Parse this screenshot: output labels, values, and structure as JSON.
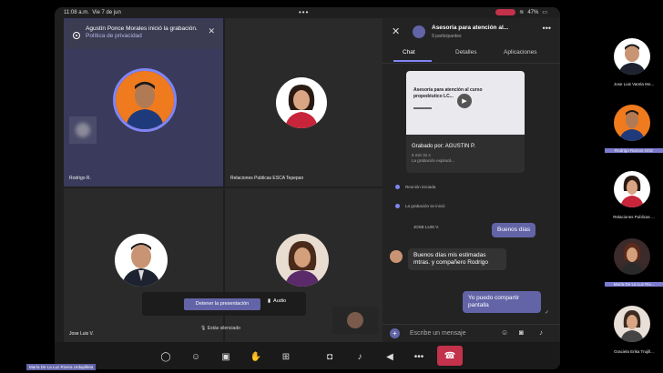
{
  "status_bar": {
    "time": "11:08 a.m.",
    "date": "Vie 7 de jun",
    "battery": "47%",
    "dots": "•••"
  },
  "notification": {
    "text": "Agustín Ponce Morales inició la grabación.",
    "link": "Política de privacidad"
  },
  "tiles": [
    {
      "name": "Rodrigo R.",
      "color": "#f07a1e"
    },
    {
      "name": "Relaciones Publicas ESCA Tepepan"
    },
    {
      "name": "Jose Luis V."
    },
    {
      "name": ""
    }
  ],
  "presentation": {
    "stop_label": "Detener la presentación",
    "audio_label": "Audio"
  },
  "muted_note": "Estás silenciado",
  "panel": {
    "title": "Asesoría para atención al...",
    "subtitle": "9 participantes",
    "tabs": [
      "Chat",
      "Detalles",
      "Aplicaciones"
    ],
    "recording": {
      "thumb_title": "Asesoría para atención al curso propedéutico LC...",
      "by": "Grabado por: AGUSTIN P.",
      "meta1": "5 min 31 s",
      "meta2": "La grabación expirará..."
    },
    "events": [
      "Reunión iniciada",
      "La grabación se inició"
    ],
    "messages": [
      {
        "from": "me",
        "text": "Buenos días"
      },
      {
        "from": "JOSE LUIS V.",
        "text": "Buenos días mis estimadas mtras. y compañero Rodrigo"
      },
      {
        "from": "me",
        "text": "Yo puedo compartir pantalla"
      }
    ],
    "compose_placeholder": "Escribe un mensaje"
  },
  "right_column": [
    {
      "name": "Jose Luis Varela Mo..."
    },
    {
      "name": "Rodrigo Ramos Ortiz",
      "highlight": true
    },
    {
      "name": "Relaciones Publicas ..."
    },
    {
      "name": "María De La Luz Riv...",
      "highlight": true
    },
    {
      "name": "Graciela Erika Trujill..."
    }
  ],
  "bottom_label": "María De La Luz Rivera Urdapilleta",
  "colors": {
    "accent": "#6264a7",
    "hangup": "#c4314b",
    "recording": "#c4314b"
  }
}
